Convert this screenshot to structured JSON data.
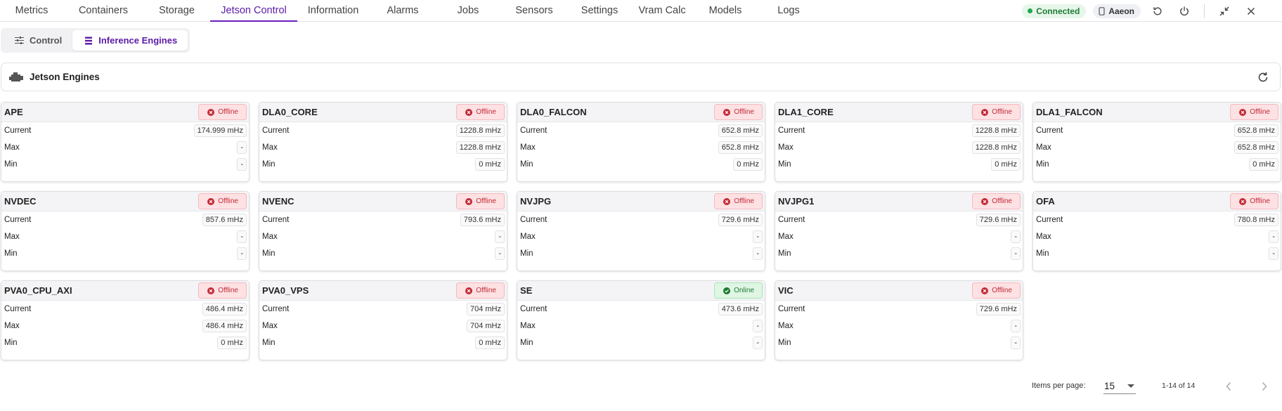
{
  "nav": {
    "tabs": [
      {
        "label": "Metrics"
      },
      {
        "label": "Containers"
      },
      {
        "label": "Storage"
      },
      {
        "label": "Jetson Control"
      },
      {
        "label": "Information"
      },
      {
        "label": "Alarms"
      },
      {
        "label": "Jobs"
      },
      {
        "label": "Sensors"
      },
      {
        "label": "Settings"
      },
      {
        "label": "Vram Calc"
      },
      {
        "label": "Models"
      },
      {
        "label": "Logs"
      }
    ],
    "active_tab": "Jetson Control",
    "status": "Connected",
    "device": "Aaeon"
  },
  "subtabs": [
    {
      "label": "Control",
      "icon": "sliders-icon"
    },
    {
      "label": "Inference Engines",
      "icon": "layers-icon"
    }
  ],
  "active_subtab": "Inference Engines",
  "panel": {
    "title": "Jetson Engines"
  },
  "row_labels": {
    "current": "Current",
    "max": "Max",
    "min": "Min"
  },
  "engines": [
    {
      "name": "APE",
      "status": "Offline",
      "current": "174.999 mHz",
      "max": "-",
      "min": "-"
    },
    {
      "name": "DLA0_CORE",
      "status": "Offline",
      "current": "1228.8 mHz",
      "max": "1228.8 mHz",
      "min": "0 mHz"
    },
    {
      "name": "DLA0_FALCON",
      "status": "Offline",
      "current": "652.8 mHz",
      "max": "652.8 mHz",
      "min": "0 mHz"
    },
    {
      "name": "DLA1_CORE",
      "status": "Offline",
      "current": "1228.8 mHz",
      "max": "1228.8 mHz",
      "min": "0 mHz"
    },
    {
      "name": "DLA1_FALCON",
      "status": "Offline",
      "current": "652.8 mHz",
      "max": "652.8 mHz",
      "min": "0 mHz"
    },
    {
      "name": "NVDEC",
      "status": "Offline",
      "current": "857.6 mHz",
      "max": "-",
      "min": "-"
    },
    {
      "name": "NVENC",
      "status": "Offline",
      "current": "793.6 mHz",
      "max": "-",
      "min": "-"
    },
    {
      "name": "NVJPG",
      "status": "Offline",
      "current": "729.6 mHz",
      "max": "-",
      "min": "-"
    },
    {
      "name": "NVJPG1",
      "status": "Offline",
      "current": "729.6 mHz",
      "max": "-",
      "min": "-"
    },
    {
      "name": "OFA",
      "status": "Offline",
      "current": "780.8 mHz",
      "max": "-",
      "min": "-"
    },
    {
      "name": "PVA0_CPU_AXI",
      "status": "Offline",
      "current": "486.4 mHz",
      "max": "486.4 mHz",
      "min": "0 mHz"
    },
    {
      "name": "PVA0_VPS",
      "status": "Offline",
      "current": "704 mHz",
      "max": "704 mHz",
      "min": "0 mHz"
    },
    {
      "name": "SE",
      "status": "Online",
      "current": "473.6 mHz",
      "max": "-",
      "min": "-"
    },
    {
      "name": "VIC",
      "status": "Offline",
      "current": "729.6 mHz",
      "max": "-",
      "min": "-"
    }
  ],
  "pagination": {
    "items_per_page_label": "Items per page:",
    "items_per_page": "15",
    "range": "1-14 of 14"
  },
  "colors": {
    "accent": "#6a1fbf",
    "offline": "#c22b37",
    "online": "#1d7a34"
  }
}
